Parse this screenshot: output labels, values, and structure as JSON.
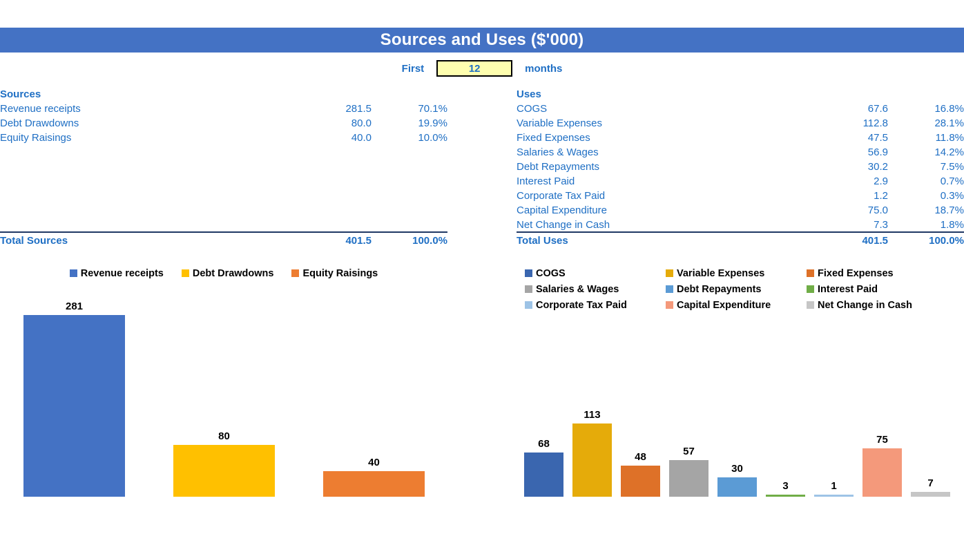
{
  "header": {
    "title": "Sources and Uses ($'000)",
    "banner_color": "#4472C4"
  },
  "period": {
    "prefix_label": "First",
    "value": "12",
    "suffix_label": "months",
    "input_bg": "#FFFFAF",
    "text_color": "#1F6FC4"
  },
  "sources": {
    "heading": "Sources",
    "rows": [
      {
        "label": "Revenue receipts",
        "value": "281.5",
        "pct": "70.1%"
      },
      {
        "label": "Debt Drawdowns",
        "value": "80.0",
        "pct": "19.9%"
      },
      {
        "label": "Equity Raisings",
        "value": "40.0",
        "pct": "10.0%"
      }
    ],
    "total": {
      "label": "Total Sources",
      "value": "401.5",
      "pct": "100.0%"
    }
  },
  "uses": {
    "heading": "Uses",
    "rows": [
      {
        "label": "COGS",
        "value": "67.6",
        "pct": "16.8%"
      },
      {
        "label": "Variable Expenses",
        "value": "112.8",
        "pct": "28.1%"
      },
      {
        "label": "Fixed Expenses",
        "value": "47.5",
        "pct": "11.8%"
      },
      {
        "label": "Salaries & Wages",
        "value": "56.9",
        "pct": "14.2%"
      },
      {
        "label": "Debt Repayments",
        "value": "30.2",
        "pct": "7.5%"
      },
      {
        "label": "Interest Paid",
        "value": "2.9",
        "pct": "0.7%"
      },
      {
        "label": "Corporate Tax Paid",
        "value": "1.2",
        "pct": "0.3%"
      },
      {
        "label": "Capital Expenditure",
        "value": "75.0",
        "pct": "18.7%"
      },
      {
        "label": "Net Change in Cash",
        "value": "7.3",
        "pct": "1.8%"
      }
    ],
    "total": {
      "label": "Total Uses",
      "value": "401.5",
      "pct": "100.0%"
    }
  },
  "chart_data": [
    {
      "type": "bar",
      "id": "sources-chart",
      "title": "",
      "xlabel": "",
      "ylabel": "",
      "grid": false,
      "legend_position": "top",
      "ylim": [
        0,
        310
      ],
      "categories": [
        "Revenue receipts",
        "Debt Drawdowns",
        "Equity Raisings"
      ],
      "values": [
        281,
        80,
        40
      ],
      "data_labels": [
        "281",
        "80",
        "40"
      ],
      "colors": [
        "#4472C4",
        "#FFC000",
        "#ED7D31"
      ]
    },
    {
      "type": "bar",
      "id": "uses-chart",
      "title": "",
      "xlabel": "",
      "ylabel": "",
      "grid": false,
      "legend_position": "top",
      "ylim": [
        0,
        310
      ],
      "categories": [
        "COGS",
        "Variable Expenses",
        "Fixed Expenses",
        "Salaries & Wages",
        "Debt Repayments",
        "Interest Paid",
        "Corporate Tax Paid",
        "Capital Expenditure",
        "Net Change in Cash"
      ],
      "values": [
        68,
        113,
        48,
        57,
        30,
        3,
        1,
        75,
        7
      ],
      "data_labels": [
        "68",
        "113",
        "48",
        "57",
        "30",
        "3",
        "1",
        "75",
        "7"
      ],
      "colors": [
        "#3A66AF",
        "#E5AB0A",
        "#DE7128",
        "#A5A5A5",
        "#5B9BD5",
        "#70AD47",
        "#9DC3E6",
        "#F4997B",
        "#C6C6C6"
      ]
    }
  ]
}
